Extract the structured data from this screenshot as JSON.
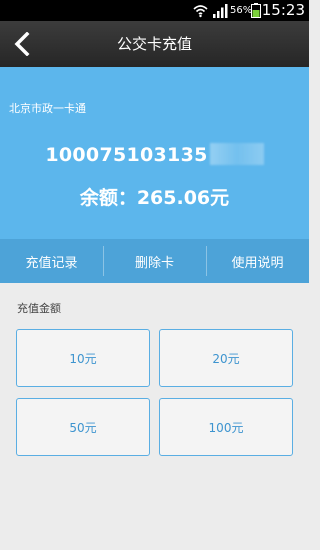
{
  "status_bar": {
    "battery_percent": "56%",
    "time": "15:23",
    "icons": [
      "wifi-icon",
      "signal-icon",
      "battery-icon"
    ]
  },
  "header": {
    "title": "公交卡充值",
    "back_icon": "back-arrow-icon"
  },
  "card": {
    "name": "北京市政一卡通",
    "number_visible": "100075103135",
    "balance": "余额：265.06元"
  },
  "actions": [
    {
      "label": "充值记录"
    },
    {
      "label": "删除卡"
    },
    {
      "label": "使用说明"
    }
  ],
  "recharge": {
    "label": "充值金额",
    "options": [
      "10元",
      "20元",
      "50元",
      "100元"
    ]
  },
  "colors": {
    "card_bg": "#5cb6ec",
    "action_bar_bg": "#4da3d8",
    "option_border": "#5aaee3",
    "option_text": "#3d94cf"
  }
}
